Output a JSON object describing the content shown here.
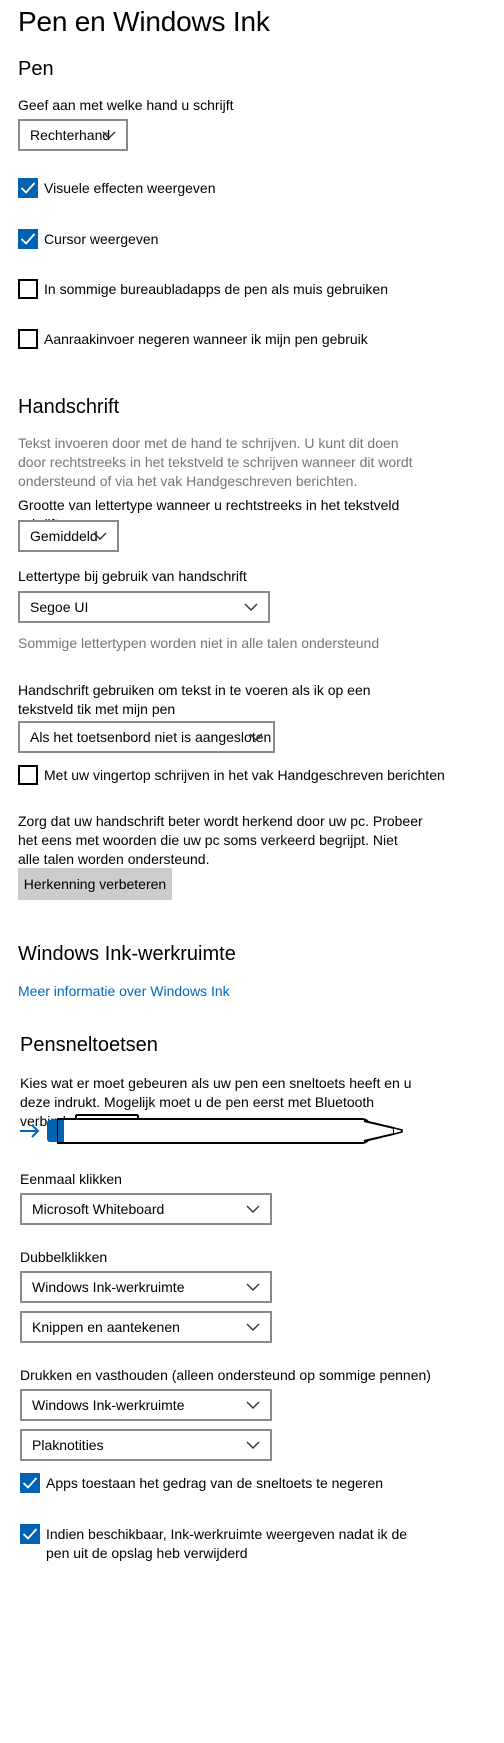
{
  "page": {
    "title": "Pen en Windows Ink"
  },
  "pen": {
    "heading": "Pen",
    "hand_label": "Geef aan met welke hand u schrijft",
    "hand_value": "Rechterhand",
    "visual_effects": {
      "label": "Visuele effecten weergeven",
      "checked": true
    },
    "cursor": {
      "label": "Cursor weergeven",
      "checked": true
    },
    "pen_as_mouse": {
      "label": "In sommige bureaubladapps de pen als muis gebruiken",
      "checked": false
    },
    "ignore_touch": {
      "label": "Aanraakinvoer negeren wanneer ik mijn pen gebruik",
      "checked": false
    }
  },
  "handwriting": {
    "heading": "Handschrift",
    "description": "Tekst invoeren door met de hand te schrijven. U kunt dit doen door rechtstreeks in het tekstveld te schrijven wanneer dit wordt ondersteund of via het vak Handgeschreven berichten.",
    "font_size_label": "Grootte van lettertype wanneer u rechtstreeks in het tekstveld schrijft",
    "font_size_value": "Gemiddeld",
    "font_label": "Lettertype bij gebruik van handschrift",
    "font_value": "Segoe UI",
    "font_note": "Sommige lettertypen worden niet in alle talen ondersteund",
    "tap_label": "Handschrift gebruiken om tekst in te voeren als ik op een tekstveld tik met mijn pen",
    "tap_value": "Als het toetsenbord niet is aangesloten",
    "fingertip": {
      "label": "Met uw vingertop schrijven in het vak Handgeschreven berichten",
      "checked": false
    },
    "recognition_text": "Zorg dat uw handschrift beter wordt herkend door uw pc. Probeer het eens met woorden die uw pc soms verkeerd begrijpt. Niet alle talen worden ondersteund.",
    "recognition_button": "Herkenning verbeteren"
  },
  "ink": {
    "heading": "Windows Ink-werkruimte",
    "link": "Meer informatie over Windows Ink"
  },
  "shortcuts": {
    "heading": "Pensneltoetsen",
    "description": "Kies wat er moet gebeuren als uw pen een sneltoets heeft en u deze indrukt. Mogelijk moet u de pen eerst met Bluetooth verbinden.",
    "single_label": "Eenmaal klikken",
    "single_value": "Microsoft Whiteboard",
    "double_label": "Dubbelklikken",
    "double_value_1": "Windows Ink-werkruimte",
    "double_value_2": "Knippen en aantekenen",
    "hold_label": "Drukken en vasthouden (alleen ondersteund op sommige pennen)",
    "hold_value_1": "Windows Ink-werkruimte",
    "hold_value_2": "Plaknotities",
    "override": {
      "label": "Apps toestaan het gedrag van de sneltoets te negeren",
      "checked": true
    },
    "show_ink": {
      "label": "Indien beschikbaar, Ink-werkruimte weergeven nadat ik de pen uit de opslag heb verwijderd",
      "checked": true
    }
  },
  "colors": {
    "accent": "#0063b1",
    "link": "#0067c0",
    "button": "#cccccc"
  }
}
